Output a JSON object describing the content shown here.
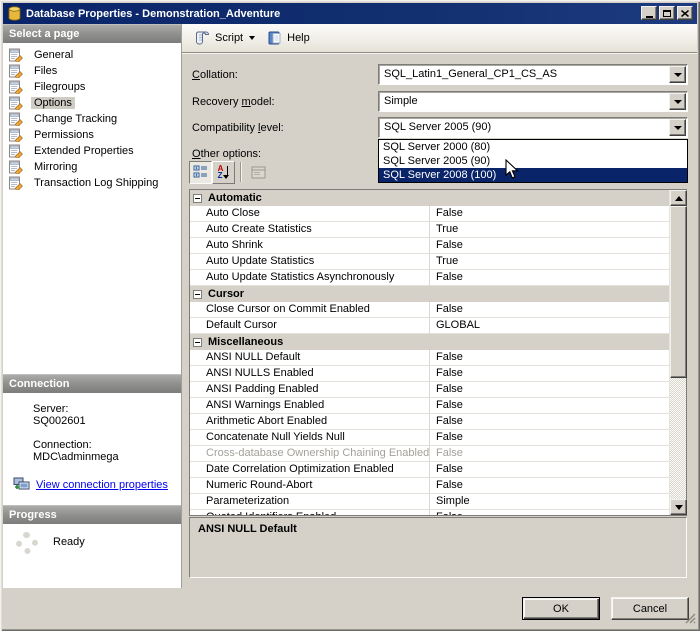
{
  "window": {
    "title": "Database Properties - Demonstration_Adventure"
  },
  "toolbar": {
    "script": "Script",
    "help": "Help"
  },
  "sidebar": {
    "select_page_header": "Select a page",
    "pages": [
      {
        "label": "General",
        "selected": false
      },
      {
        "label": "Files",
        "selected": false
      },
      {
        "label": "Filegroups",
        "selected": false
      },
      {
        "label": "Options",
        "selected": true
      },
      {
        "label": "Change Tracking",
        "selected": false
      },
      {
        "label": "Permissions",
        "selected": false
      },
      {
        "label": "Extended Properties",
        "selected": false
      },
      {
        "label": "Mirroring",
        "selected": false
      },
      {
        "label": "Transaction Log Shipping",
        "selected": false
      }
    ],
    "connection_header": "Connection",
    "server_label": "Server:",
    "server_value": "SQ002601",
    "connection_label": "Connection:",
    "connection_value": "MDC\\adminmega",
    "view_connection_link": "View connection properties",
    "progress_header": "Progress",
    "progress_status": "Ready"
  },
  "fields": {
    "collation": {
      "label_pre": "",
      "label_key": "C",
      "label_post": "ollation:",
      "value": "SQL_Latin1_General_CP1_CS_AS"
    },
    "recovery_model": {
      "label_pre": "Recovery ",
      "label_key": "m",
      "label_post": "odel:",
      "value": "Simple"
    },
    "compatibility_level": {
      "label_pre": "Compatibility ",
      "label_key": "l",
      "label_post": "evel:",
      "value": "SQL Server 2005 (90)"
    },
    "other_options": {
      "label_pre": "",
      "label_key": "O",
      "label_post": "ther options:"
    }
  },
  "compat_dropdown": {
    "options": [
      "SQL Server 2000 (80)",
      "SQL Server 2005 (90)",
      "SQL Server 2008 (100)"
    ],
    "highlighted_index": 2
  },
  "grid": {
    "sections": [
      {
        "name": "Automatic",
        "rows": [
          {
            "label": "Auto Close",
            "value": "False"
          },
          {
            "label": "Auto Create Statistics",
            "value": "True"
          },
          {
            "label": "Auto Shrink",
            "value": "False"
          },
          {
            "label": "Auto Update Statistics",
            "value": "True"
          },
          {
            "label": "Auto Update Statistics Asynchronously",
            "value": "False"
          }
        ]
      },
      {
        "name": "Cursor",
        "rows": [
          {
            "label": "Close Cursor on Commit Enabled",
            "value": "False"
          },
          {
            "label": "Default Cursor",
            "value": "GLOBAL"
          }
        ]
      },
      {
        "name": "Miscellaneous",
        "rows": [
          {
            "label": "ANSI NULL Default",
            "value": "False"
          },
          {
            "label": "ANSI NULLS Enabled",
            "value": "False"
          },
          {
            "label": "ANSI Padding Enabled",
            "value": "False"
          },
          {
            "label": "ANSI Warnings Enabled",
            "value": "False"
          },
          {
            "label": "Arithmetic Abort Enabled",
            "value": "False"
          },
          {
            "label": "Concatenate Null Yields Null",
            "value": "False"
          },
          {
            "label": "Cross-database Ownership Chaining Enabled",
            "value": "False",
            "disabled": true
          },
          {
            "label": "Date Correlation Optimization Enabled",
            "value": "False"
          },
          {
            "label": "Numeric Round-Abort",
            "value": "False"
          },
          {
            "label": "Parameterization",
            "value": "Simple"
          },
          {
            "label": "Quoted Identifiers Enabled",
            "value": "False"
          }
        ]
      }
    ]
  },
  "description_panel": {
    "title": "ANSI NULL Default"
  },
  "action_buttons": {
    "ok": "OK",
    "cancel": "Cancel"
  },
  "icons": {
    "letter_a": "A",
    "letter_z": "Z"
  },
  "colors": {
    "titlebar": "#0a246a",
    "selection": "#0a246a",
    "link": "#0000ee",
    "dialog_bg": "#d5d1c8"
  }
}
